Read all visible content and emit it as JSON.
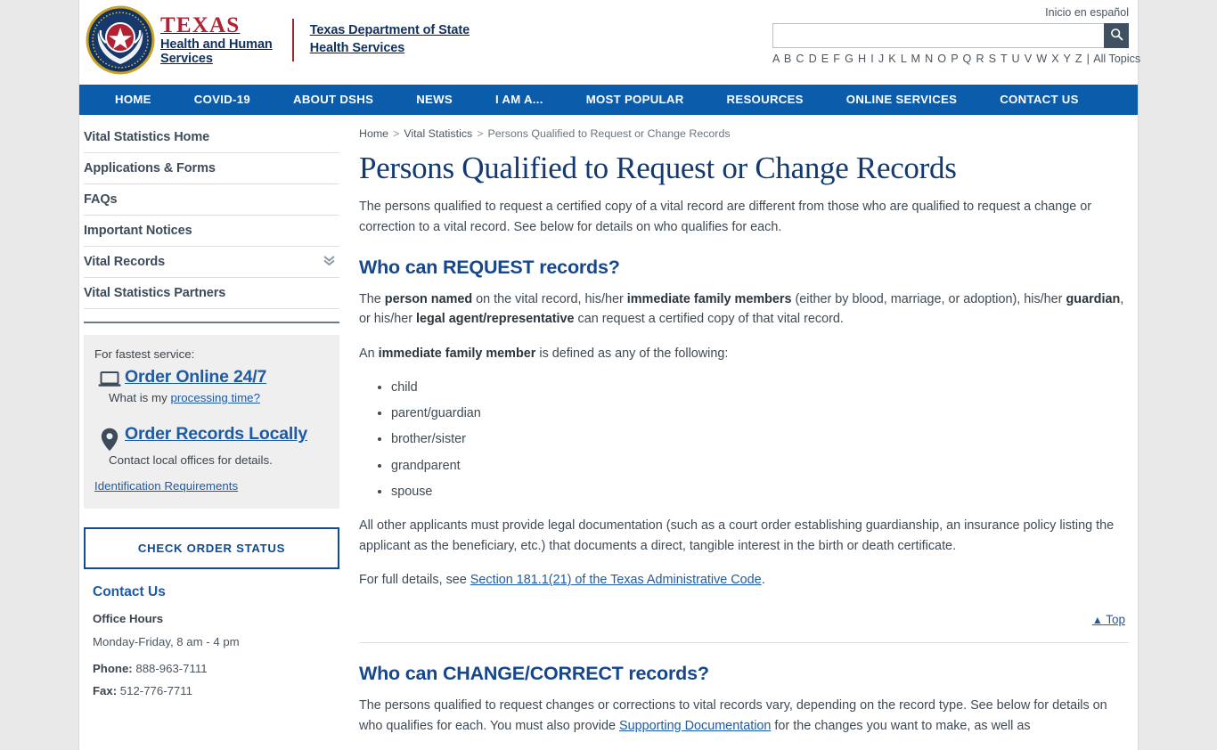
{
  "header": {
    "logo": {
      "seal_alt": "texas-state-seal",
      "texas": "TEXAS",
      "hhs_line1": "Health and Human",
      "hhs_line2": "Services",
      "dept_line1": "Texas Department of State",
      "dept_line2": "Health Services"
    },
    "espanol_link": "Inicio en español",
    "search": {
      "value": "",
      "placeholder": "",
      "button_icon": "search-icon"
    },
    "alphabet": [
      "A",
      "B",
      "C",
      "D",
      "E",
      "F",
      "G",
      "H",
      "I",
      "J",
      "K",
      "L",
      "M",
      "N",
      "O",
      "P",
      "Q",
      "R",
      "S",
      "T",
      "U",
      "V",
      "W",
      "X",
      "Y",
      "Z"
    ],
    "alphabet_separator": "|",
    "all_topics": "All Topics"
  },
  "nav": {
    "items": [
      {
        "label": "HOME"
      },
      {
        "label": "COVID-19"
      },
      {
        "label": "ABOUT DSHS"
      },
      {
        "label": "NEWS"
      },
      {
        "label": "I AM A..."
      },
      {
        "label": "MOST POPULAR"
      },
      {
        "label": "RESOURCES"
      },
      {
        "label": "ONLINE SERVICES"
      },
      {
        "label": "CONTACT US"
      }
    ]
  },
  "sidebar": {
    "nav_items": [
      {
        "label": "Vital Statistics Home",
        "has_chevron": false
      },
      {
        "label": "Applications & Forms",
        "has_chevron": false
      },
      {
        "label": "FAQs",
        "has_chevron": false
      },
      {
        "label": "Important Notices",
        "has_chevron": false
      },
      {
        "label": "Vital Records",
        "has_chevron": true
      },
      {
        "label": "Vital Statistics Partners",
        "has_chevron": false
      }
    ],
    "chevron_glyph": "⌄⌄",
    "service_box": {
      "fastest_label": "For fastest service:",
      "order_online_label": "Order Online 24/7",
      "order_online_icon": "laptop-icon",
      "processing_prefix": "What is my ",
      "processing_link": "processing time?",
      "order_locally_label": "Order Records Locally",
      "order_locally_icon": "map-pin-icon",
      "order_locally_sub": "Contact local offices for details.",
      "identification_link": "Identification Requirements"
    },
    "check_order_status": "CHECK ORDER STATUS",
    "contact": {
      "heading": "Contact Us",
      "office_hours_label": "Office Hours",
      "office_hours_value": "Monday-Friday, 8 am - 4 pm",
      "phone_label": "Phone:",
      "phone_value": "888-963-7111",
      "fax_label": "Fax:",
      "fax_value": "512-776-7711"
    }
  },
  "main": {
    "breadcrumb": {
      "home": "Home",
      "vital_statistics": "Vital Statistics",
      "current": "Persons Qualified to Request or Change Records",
      "separator": ">"
    },
    "title": "Persons Qualified to Request or Change Records",
    "intro": "The persons qualified to request a certified copy of a vital record are different from those who are qualified to request a change or correction to a vital record. See below for details on who qualifies for each.",
    "request_section": {
      "heading": "Who can REQUEST records?",
      "para1_p1": "The ",
      "para1_b1": "person named",
      "para1_p2": " on the vital record, his/her ",
      "para1_b2": "immediate family members",
      "para1_p3": " (either by blood, marriage, or adoption), his/her ",
      "para1_b3": "guardian",
      "para1_p4": ", or his/her ",
      "para1_b4": "legal agent/representative",
      "para1_p5": " can request a certified copy of that vital record.",
      "para2_p1": "An ",
      "para2_b1": "immediate family member",
      "para2_p2": " is defined as any of the following:",
      "family_list": [
        "child",
        "parent/guardian",
        "brother/sister",
        "grandparent",
        "spouse"
      ],
      "para3": "All other applicants must provide legal documentation (such as a court order establishing guardianship, an insurance policy listing the applicant as the beneficiary, etc.) that documents a direct, tangible interest in the birth or death certificate.",
      "para4_prefix": "For full details, see ",
      "para4_link": "Section 181.1(21) of the Texas Administrative Code",
      "para4_suffix": "."
    },
    "top_link": {
      "glyph": "▲",
      "label": "Top"
    },
    "change_section": {
      "heading": "Who can CHANGE/CORRECT records?",
      "para1_p1": "The persons qualified to request changes or corrections to vital records vary, depending on the record type. See below for details on who qualifies for each. ",
      "para1_p2": "You must also provide ",
      "para1_link": "Supporting Documentation",
      "para1_p3": " for the changes you want to make, as well as"
    }
  },
  "colors": {
    "brand_blue": "#0b5cab",
    "nav_blue": "#0b5cab",
    "link_blue": "#1d5ba4",
    "title_navy": "#123a70",
    "heading_navy": "#16478c",
    "seal_red": "#b22234",
    "seal_navy": "#11325e",
    "search_btn": "#3f5160",
    "page_bg": "#e9e9e9",
    "box_gray": "#efefef"
  }
}
